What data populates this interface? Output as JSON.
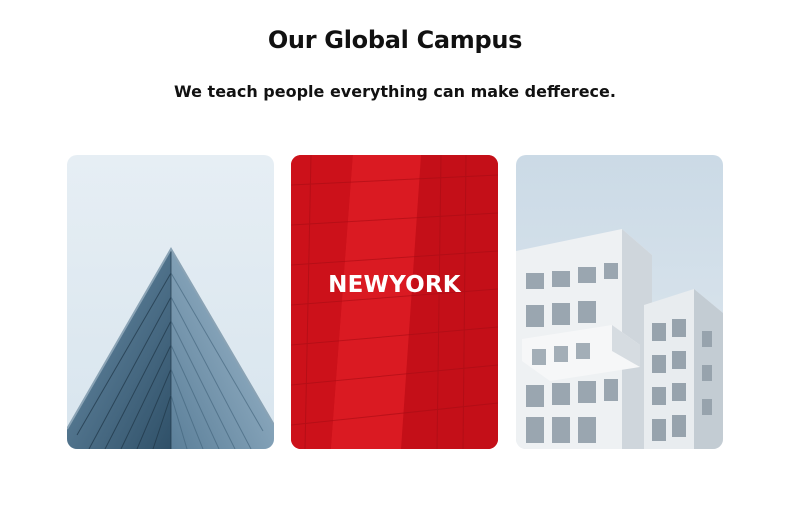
{
  "section": {
    "title": "Our Global Campus",
    "subtitle": "We teach people everything can make defferece."
  },
  "campuses": [
    {
      "label": "",
      "image": "glass-pyramid-building-photo"
    },
    {
      "label": "NEWYORK",
      "image": "red-glass-building-photo"
    },
    {
      "label": "",
      "image": "white-modern-building-photo"
    }
  ],
  "colors": {
    "overlay_red": "#d9121b",
    "sky": "#dce8f0",
    "text": "#111111"
  }
}
